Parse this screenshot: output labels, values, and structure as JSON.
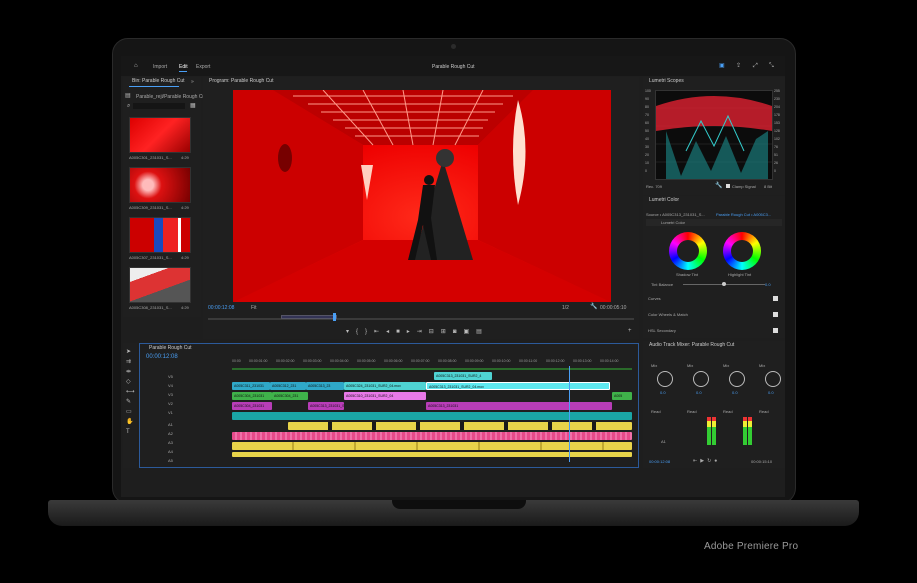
{
  "caption": "Adobe Premiere Pro",
  "app": {
    "title": "Parable Rough Cut",
    "workspaces": [
      "Import",
      "Edit",
      "Export"
    ],
    "active_workspace": "Edit"
  },
  "bin": {
    "tab_label": "Bin: Parable Rough Cut",
    "path": "Parable_reji/Parable Rough Cut",
    "items": [
      {
        "name": "A005C301_231031_S...",
        "duration": "4:29"
      },
      {
        "name": "A005C309_231031_S...",
        "duration": "4:29"
      },
      {
        "name": "A005C307_231031_S...",
        "duration": "4:29"
      },
      {
        "name": "A005C308_231031_S...",
        "duration": "4:29"
      }
    ]
  },
  "program": {
    "tab_label": "Program: Parable Rough Cut",
    "timecode": "00:00:12:08",
    "fit": "Fit",
    "resolution": "1/2",
    "duration": "00:00:05:10"
  },
  "scopes": {
    "tab_label": "Lumetri Scopes",
    "scale": [
      "100",
      "90",
      "80",
      "70",
      "60",
      "50",
      "40",
      "30",
      "20",
      "10",
      "0"
    ],
    "right_scale": [
      "255",
      "230",
      "204",
      "178",
      "153",
      "128",
      "102",
      "76",
      "51",
      "26",
      "0"
    ],
    "bottom_left": "Rec. 709",
    "clamp_label": "Clamp Signal",
    "bits": "8 Bit"
  },
  "lumetri": {
    "tab_label": "Lumetri Color",
    "source": "Source • A005C313_231031_S...",
    "target": "Parable Rough Cut • A005C3...",
    "effect": "Lumetri Color",
    "shadow_label": "Shadow Tint",
    "highlight_label": "Highlight Tint",
    "tint_balance_label": "Tint Balance",
    "tint_balance_value": "0.0",
    "sections": [
      "Curves",
      "Color Wheels & Match",
      "HSL Secondary"
    ]
  },
  "timeline": {
    "tab_label": "Parable Rough Cut",
    "timecode": "00:00:12:08",
    "ruler": [
      "00:00",
      "00:00:01:00",
      "00:00:02:00",
      "00:00:03:00",
      "00:00:04:00",
      "00:00:05:00",
      "00:00:06:00",
      "00:00:07:00",
      "00:00:08:00",
      "00:00:09:00",
      "00:00:10:00",
      "00:00:11:00",
      "00:00:12:00",
      "00:00:13:00",
      "00:00:14:00"
    ],
    "tracks": [
      {
        "id": "V5",
        "name": "V5"
      },
      {
        "id": "V4",
        "name": "V4"
      },
      {
        "id": "V3",
        "name": "V3"
      },
      {
        "id": "V2",
        "name": "V2"
      },
      {
        "id": "V1",
        "name": "V1"
      },
      {
        "id": "A1",
        "name": "A1"
      },
      {
        "id": "A2",
        "name": "A2"
      },
      {
        "id": "A3",
        "name": "A3"
      },
      {
        "id": "A4",
        "name": "A4"
      },
      {
        "id": "A5",
        "name": "A5"
      }
    ],
    "clips": {
      "v4_top": "A005C313_231031_SUR2_4",
      "v4": [
        "A005C311_231031",
        "A005C312_231",
        "A005C313_23",
        "A005C324_231031_SUR2_04.mov",
        "A005C313_231031_SUR2_04.mov"
      ],
      "v3": [
        "A005C304_231031",
        "A005C304_231",
        "A005C310_231031_SUR2_04",
        "A005"
      ],
      "v2": [
        "A005C304_231031",
        "A005C313_231031_SUR2_04",
        "A005C313_231031"
      ]
    }
  },
  "mixer": {
    "tab_label": "Audio Track Mixer: Parable Rough Cut",
    "channels": [
      {
        "mode": "Mix",
        "value": "0.0",
        "read": "Read",
        "track": "A1"
      },
      {
        "mode": "Mix",
        "value": "0.0",
        "read": "Read",
        "track": "A2"
      },
      {
        "mode": "Mix",
        "value": "0.0",
        "read": "Read",
        "track": "A3"
      },
      {
        "mode": "Mix",
        "value": "0.0",
        "read": "Read",
        "track": "A4"
      }
    ],
    "timecode_left": "00:00:12:08",
    "timecode_right": "00:00:15:10"
  }
}
